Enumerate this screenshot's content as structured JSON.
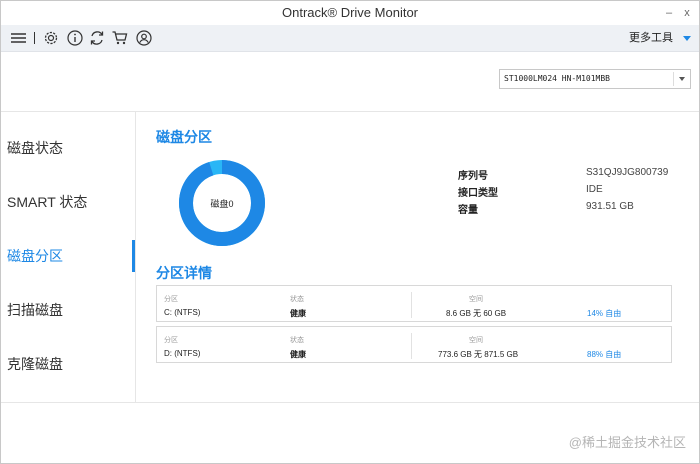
{
  "window": {
    "title": "Ontrack® Drive Monitor",
    "minimize_label": "–",
    "close_label": "x"
  },
  "toolbar": {
    "icons": [
      "menu-icon",
      "gear-icon",
      "info-icon",
      "refresh-icon",
      "cart-icon",
      "user-icon"
    ],
    "more_tools_label": "更多工具"
  },
  "drive_select": {
    "value": "ST1000LM024 HN-M101MBB"
  },
  "sidebar": {
    "items": [
      {
        "label": "磁盘状态"
      },
      {
        "label": "SMART 状态"
      },
      {
        "label": "磁盘分区"
      },
      {
        "label": "扫描磁盘"
      },
      {
        "label": "克隆磁盘"
      }
    ],
    "active_index": 2
  },
  "main": {
    "partition_section_title": "磁盘分区",
    "disk_donut": {
      "label": "磁盘0",
      "used_fraction": 0.95,
      "colors": {
        "primary": "#1e88e5",
        "secondary": "#29b6f6"
      }
    },
    "disk_info": [
      {
        "label": "序列号",
        "value": "S31QJ9JG800739"
      },
      {
        "label": "接口类型",
        "value": "IDE"
      },
      {
        "label": "容量",
        "value": "931.51 GB"
      }
    ],
    "details_section_title": "分区详情",
    "partitions": [
      {
        "col_partition": "分区",
        "name": "C: (NTFS)",
        "col_status": "状态",
        "status": "健康",
        "col_space": "空间",
        "space": "8.6 GB 无 60 GB",
        "free": "14% 自由"
      },
      {
        "col_partition": "分区",
        "name": "D: (NTFS)",
        "col_status": "状态",
        "status": "健康",
        "col_space": "空间",
        "space": "773.6 GB 无 871.5 GB",
        "free": "88% 自由"
      }
    ]
  },
  "watermark": "@稀土掘金技术社区",
  "colors": {
    "accent": "#1e88e5",
    "toolbar_bg": "#eef1f5"
  }
}
